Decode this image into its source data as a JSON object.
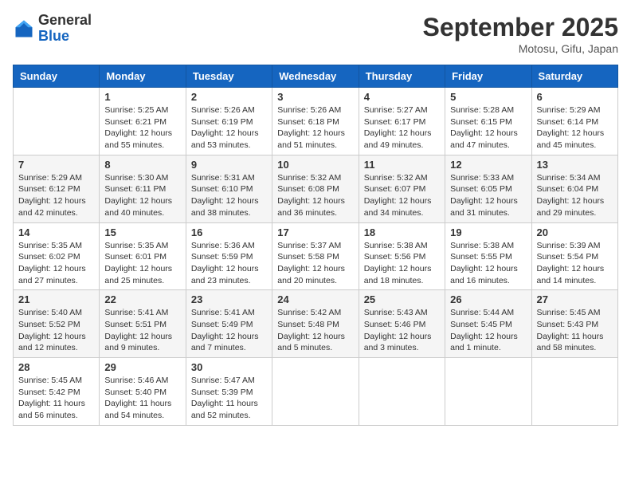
{
  "header": {
    "logo": {
      "line1": "General",
      "line2": "Blue"
    },
    "title": "September 2025",
    "location": "Motosu, Gifu, Japan"
  },
  "weekdays": [
    "Sunday",
    "Monday",
    "Tuesday",
    "Wednesday",
    "Thursday",
    "Friday",
    "Saturday"
  ],
  "weeks": [
    [
      {
        "day": "",
        "info": ""
      },
      {
        "day": "1",
        "info": "Sunrise: 5:25 AM\nSunset: 6:21 PM\nDaylight: 12 hours\nand 55 minutes."
      },
      {
        "day": "2",
        "info": "Sunrise: 5:26 AM\nSunset: 6:19 PM\nDaylight: 12 hours\nand 53 minutes."
      },
      {
        "day": "3",
        "info": "Sunrise: 5:26 AM\nSunset: 6:18 PM\nDaylight: 12 hours\nand 51 minutes."
      },
      {
        "day": "4",
        "info": "Sunrise: 5:27 AM\nSunset: 6:17 PM\nDaylight: 12 hours\nand 49 minutes."
      },
      {
        "day": "5",
        "info": "Sunrise: 5:28 AM\nSunset: 6:15 PM\nDaylight: 12 hours\nand 47 minutes."
      },
      {
        "day": "6",
        "info": "Sunrise: 5:29 AM\nSunset: 6:14 PM\nDaylight: 12 hours\nand 45 minutes."
      }
    ],
    [
      {
        "day": "7",
        "info": "Sunrise: 5:29 AM\nSunset: 6:12 PM\nDaylight: 12 hours\nand 42 minutes."
      },
      {
        "day": "8",
        "info": "Sunrise: 5:30 AM\nSunset: 6:11 PM\nDaylight: 12 hours\nand 40 minutes."
      },
      {
        "day": "9",
        "info": "Sunrise: 5:31 AM\nSunset: 6:10 PM\nDaylight: 12 hours\nand 38 minutes."
      },
      {
        "day": "10",
        "info": "Sunrise: 5:32 AM\nSunset: 6:08 PM\nDaylight: 12 hours\nand 36 minutes."
      },
      {
        "day": "11",
        "info": "Sunrise: 5:32 AM\nSunset: 6:07 PM\nDaylight: 12 hours\nand 34 minutes."
      },
      {
        "day": "12",
        "info": "Sunrise: 5:33 AM\nSunset: 6:05 PM\nDaylight: 12 hours\nand 31 minutes."
      },
      {
        "day": "13",
        "info": "Sunrise: 5:34 AM\nSunset: 6:04 PM\nDaylight: 12 hours\nand 29 minutes."
      }
    ],
    [
      {
        "day": "14",
        "info": "Sunrise: 5:35 AM\nSunset: 6:02 PM\nDaylight: 12 hours\nand 27 minutes."
      },
      {
        "day": "15",
        "info": "Sunrise: 5:35 AM\nSunset: 6:01 PM\nDaylight: 12 hours\nand 25 minutes."
      },
      {
        "day": "16",
        "info": "Sunrise: 5:36 AM\nSunset: 5:59 PM\nDaylight: 12 hours\nand 23 minutes."
      },
      {
        "day": "17",
        "info": "Sunrise: 5:37 AM\nSunset: 5:58 PM\nDaylight: 12 hours\nand 20 minutes."
      },
      {
        "day": "18",
        "info": "Sunrise: 5:38 AM\nSunset: 5:56 PM\nDaylight: 12 hours\nand 18 minutes."
      },
      {
        "day": "19",
        "info": "Sunrise: 5:38 AM\nSunset: 5:55 PM\nDaylight: 12 hours\nand 16 minutes."
      },
      {
        "day": "20",
        "info": "Sunrise: 5:39 AM\nSunset: 5:54 PM\nDaylight: 12 hours\nand 14 minutes."
      }
    ],
    [
      {
        "day": "21",
        "info": "Sunrise: 5:40 AM\nSunset: 5:52 PM\nDaylight: 12 hours\nand 12 minutes."
      },
      {
        "day": "22",
        "info": "Sunrise: 5:41 AM\nSunset: 5:51 PM\nDaylight: 12 hours\nand 9 minutes."
      },
      {
        "day": "23",
        "info": "Sunrise: 5:41 AM\nSunset: 5:49 PM\nDaylight: 12 hours\nand 7 minutes."
      },
      {
        "day": "24",
        "info": "Sunrise: 5:42 AM\nSunset: 5:48 PM\nDaylight: 12 hours\nand 5 minutes."
      },
      {
        "day": "25",
        "info": "Sunrise: 5:43 AM\nSunset: 5:46 PM\nDaylight: 12 hours\nand 3 minutes."
      },
      {
        "day": "26",
        "info": "Sunrise: 5:44 AM\nSunset: 5:45 PM\nDaylight: 12 hours\nand 1 minute."
      },
      {
        "day": "27",
        "info": "Sunrise: 5:45 AM\nSunset: 5:43 PM\nDaylight: 11 hours\nand 58 minutes."
      }
    ],
    [
      {
        "day": "28",
        "info": "Sunrise: 5:45 AM\nSunset: 5:42 PM\nDaylight: 11 hours\nand 56 minutes."
      },
      {
        "day": "29",
        "info": "Sunrise: 5:46 AM\nSunset: 5:40 PM\nDaylight: 11 hours\nand 54 minutes."
      },
      {
        "day": "30",
        "info": "Sunrise: 5:47 AM\nSunset: 5:39 PM\nDaylight: 11 hours\nand 52 minutes."
      },
      {
        "day": "",
        "info": ""
      },
      {
        "day": "",
        "info": ""
      },
      {
        "day": "",
        "info": ""
      },
      {
        "day": "",
        "info": ""
      }
    ]
  ]
}
